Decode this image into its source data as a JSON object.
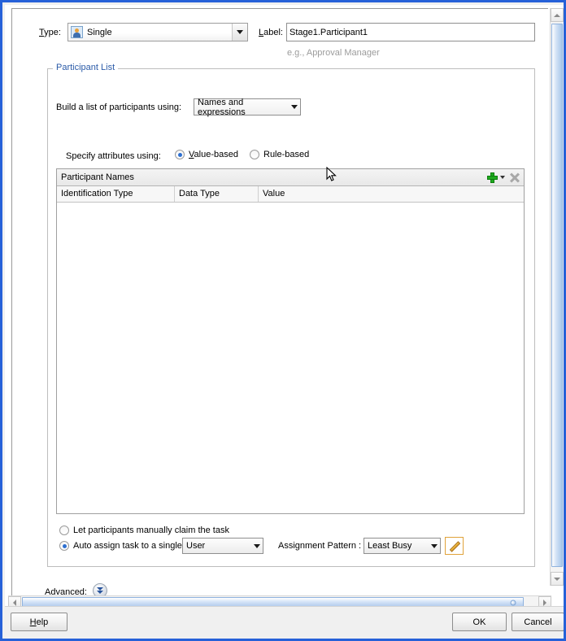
{
  "dialog": {
    "type_row": {
      "type_label": "Type:",
      "type_mnemonic": "T",
      "type_value": "Single",
      "type_icon": "user-icon",
      "label_label": "Label:",
      "label_mnemonic": "L",
      "label_value": "Stage1.Participant1",
      "label_hint": "e.g., Approval Manager"
    },
    "participant_list": {
      "legend": "Participant List",
      "legend_color": "#2b5ba8",
      "build_label": "Build a list of participants using:",
      "build_value": "Names and expressions",
      "specify_label": "Specify attributes using:",
      "radios": [
        {
          "label": "Value-based",
          "mnemonic": "V",
          "checked": true
        },
        {
          "label": "Rule-based",
          "mnemonic": "",
          "checked": false
        }
      ],
      "table": {
        "toolbar_title": "Participant Names",
        "add_icon": "plus-icon",
        "add_dropdown_icon": "caret-down-icon",
        "delete_icon": "x-icon",
        "columns": [
          "Identification Type",
          "Data Type",
          "Value"
        ],
        "rows": []
      },
      "assignment": {
        "manual_option": "Let participants manually claim the task",
        "manual_checked": false,
        "auto_option": "Auto assign task to a single",
        "auto_checked": true,
        "auto_target": "User",
        "pattern_label": "Assignment Pattern :",
        "pattern_value": "Least Busy",
        "edit_icon": "pencil-icon"
      }
    },
    "advanced": {
      "label": "Advanced:",
      "toggle_icon": "double-chevron-down-icon"
    },
    "buttons": {
      "help": "Help",
      "help_mnemonic": "H",
      "ok": "OK",
      "cancel": "Cancel"
    },
    "scrollbars": {
      "vertical_up_icon": "arrow-up-icon",
      "vertical_down_icon": "arrow-down-icon",
      "horizontal_left_icon": "arrow-left-icon",
      "horizontal_right_icon": "arrow-right-icon"
    },
    "colors": {
      "frame_border": "#2661d8",
      "legend_text": "#2b5ba8",
      "hint_text": "#9c9c9c",
      "add_icon_green": "#1faa1f",
      "pencil_orange": "#e0a23a",
      "radio_dot": "#2d6fd0"
    }
  }
}
